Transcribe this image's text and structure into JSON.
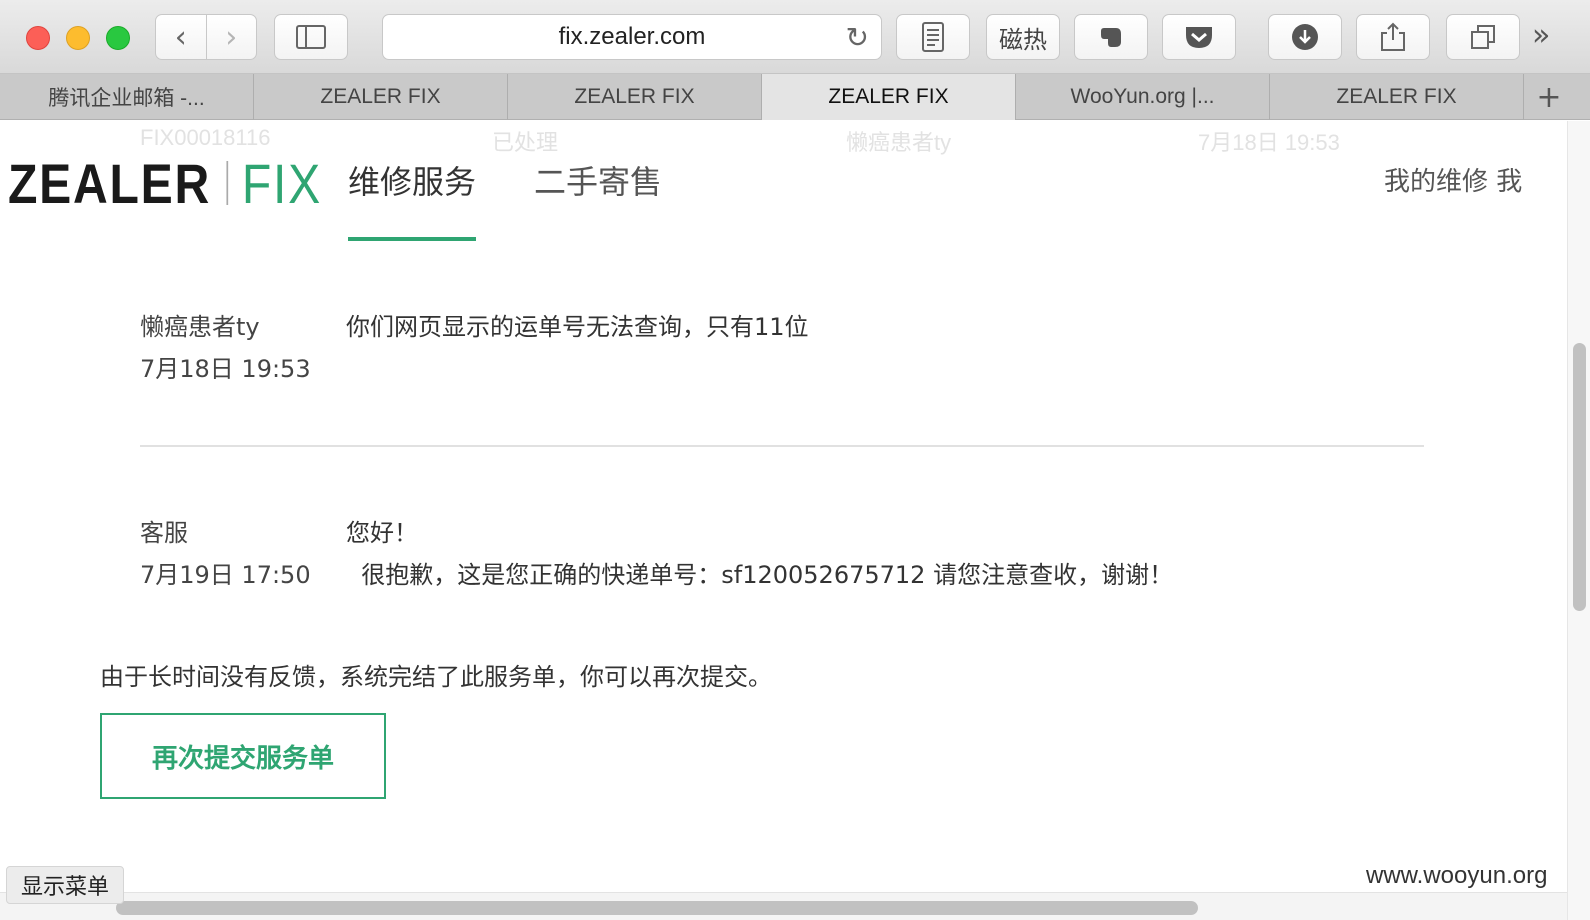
{
  "browser": {
    "url": "fix.zealer.com",
    "sidebar_icon": "sidebar-icon",
    "tabs": [
      {
        "label": "腾讯企业邮箱 -...",
        "active": false
      },
      {
        "label": "ZEALER FIX",
        "active": false
      },
      {
        "label": "ZEALER FIX",
        "active": false
      },
      {
        "label": "ZEALER FIX",
        "active": true
      },
      {
        "label": "WooYun.org |...",
        "active": false
      },
      {
        "label": "ZEALER FIX",
        "active": false
      }
    ],
    "extension_label": "磁热"
  },
  "ghost_row": {
    "id": "FIX00018116",
    "status": "已处理",
    "user": "懒癌患者ty",
    "time": "7月18日 19:53"
  },
  "site": {
    "logo_main": "ZEALER",
    "logo_accent": "FIX",
    "accent_color": "#2fa572",
    "nav": [
      {
        "label": "维修服务",
        "active": true
      },
      {
        "label": "二手寄售",
        "active": false
      }
    ],
    "right_nav": "我的维修  我"
  },
  "messages": [
    {
      "author": "懒癌患者ty",
      "time": "7月18日 19:53",
      "line1": "你们网页显示的运单号无法查询，只有11位",
      "line2": ""
    },
    {
      "author": "客服",
      "time": "7月19日 17:50",
      "line1": "您好！",
      "line2": "  很抱歉，这是您正确的快递单号：sf120052675712 请您注意查收，谢谢！"
    }
  ],
  "notice": "由于长时间没有反馈，系统完结了此服务单，你可以再次提交。",
  "resubmit_label": "再次提交服务单",
  "show_menu_label": "显示菜单",
  "watermark": "www.wooyun.org"
}
